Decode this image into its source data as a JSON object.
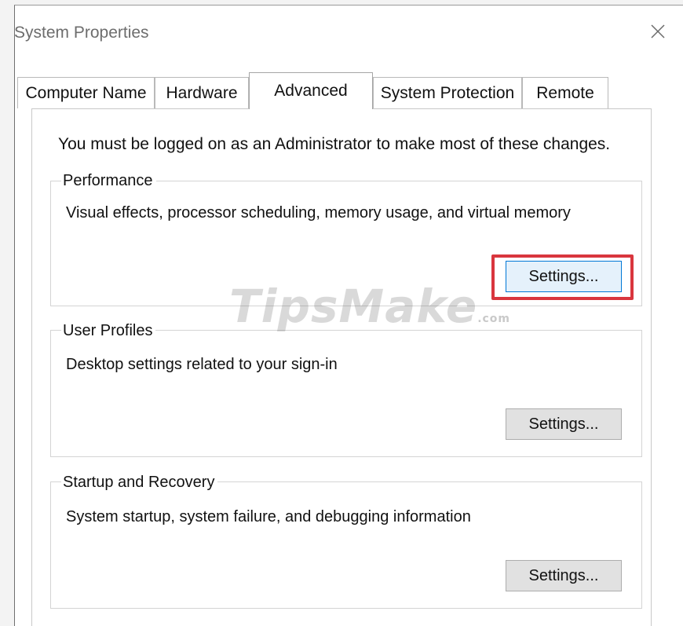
{
  "window": {
    "title": "System Properties",
    "close_icon": "close-icon"
  },
  "tabs": [
    {
      "label": "Computer Name",
      "active": false
    },
    {
      "label": "Hardware",
      "active": false
    },
    {
      "label": "Advanced",
      "active": true
    },
    {
      "label": "System Protection",
      "active": false
    },
    {
      "label": "Remote",
      "active": false
    }
  ],
  "admin_note": "You must be logged on as an Administrator to make most of these changes.",
  "groups": {
    "performance": {
      "label": "Performance",
      "description": "Visual effects, processor scheduling, memory usage, and virtual memory",
      "button": "Settings..."
    },
    "user_profiles": {
      "label": "User Profiles",
      "description": "Desktop settings related to your sign-in",
      "button": "Settings..."
    },
    "startup_recovery": {
      "label": "Startup and Recovery",
      "description": "System startup, system failure, and debugging information",
      "button": "Settings..."
    }
  },
  "watermark": {
    "brand": "TipsMake",
    "suffix": ".com"
  },
  "colors": {
    "highlight": "#d9363e",
    "focus_border": "#0078d7"
  }
}
